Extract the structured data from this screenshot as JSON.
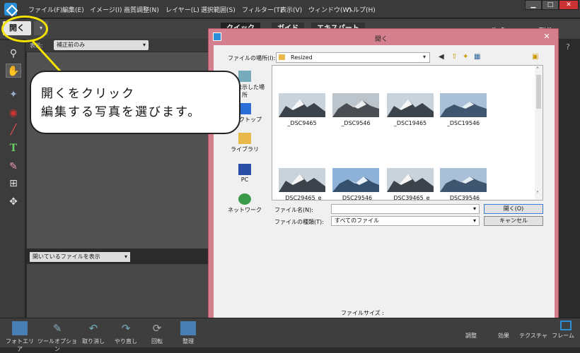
{
  "menubar": {
    "items": [
      "ファイル(F)",
      "編集(E)",
      "イメージ(I)",
      "画質調整(N)",
      "レイヤー(L)",
      "選択範囲(S)",
      "フィルター(T)",
      "表示(V)",
      "ウィンドウ(W)",
      "ヘルプ(H)"
    ],
    "min": "▁",
    "max": "□",
    "close": "✕"
  },
  "toolbar": {
    "open_label": "開く",
    "open_arrow": "▾",
    "tabs": [
      "クイック",
      "ガイド",
      "エキスパート"
    ],
    "create": "作成",
    "share": "配信"
  },
  "panel": {
    "view_label": "表示:",
    "view_value": "補正前のみ",
    "bin_value": "開いているファイルを表示",
    "caret": "▾"
  },
  "callout": {
    "line1": "開くをクリック",
    "line2": "編集する写真を選びます。"
  },
  "dialog": {
    "title": "開く",
    "close": "✕",
    "lookin_label": "ファイルの場所(I):",
    "lookin_value": "Resized",
    "places": [
      "最近表示した場所",
      "デスクトップ",
      "ライブラリ",
      "PC",
      "ネットワーク"
    ],
    "files_row1": [
      "_DSC9465",
      "_DSC9546",
      "_DSC19465",
      "_DSC19546"
    ],
    "files_row2": [
      "_DSC29465_e",
      "_DSC29546",
      "_DSC39465_e",
      "_DSC39546"
    ],
    "filename_label": "ファイル名(N):",
    "filename_value": "",
    "filetype_label": "ファイルの種類(T):",
    "filetype_value": "すべてのファイル",
    "open_button": "開く(O)",
    "cancel_button": "キャンセル",
    "filesize_label": "ファイルサイズ :"
  },
  "bottombar": {
    "items": [
      "フォトエリア",
      "ツールオプション",
      "取り消し",
      "やり直し",
      "回転",
      "整理"
    ],
    "right_items": [
      "調整",
      "効果",
      "テクスチャ",
      "フレーム"
    ]
  },
  "colors": {
    "accent": "#2a8fd6",
    "dialog_frame": "#d47f8d",
    "highlight": "#f5e400"
  }
}
